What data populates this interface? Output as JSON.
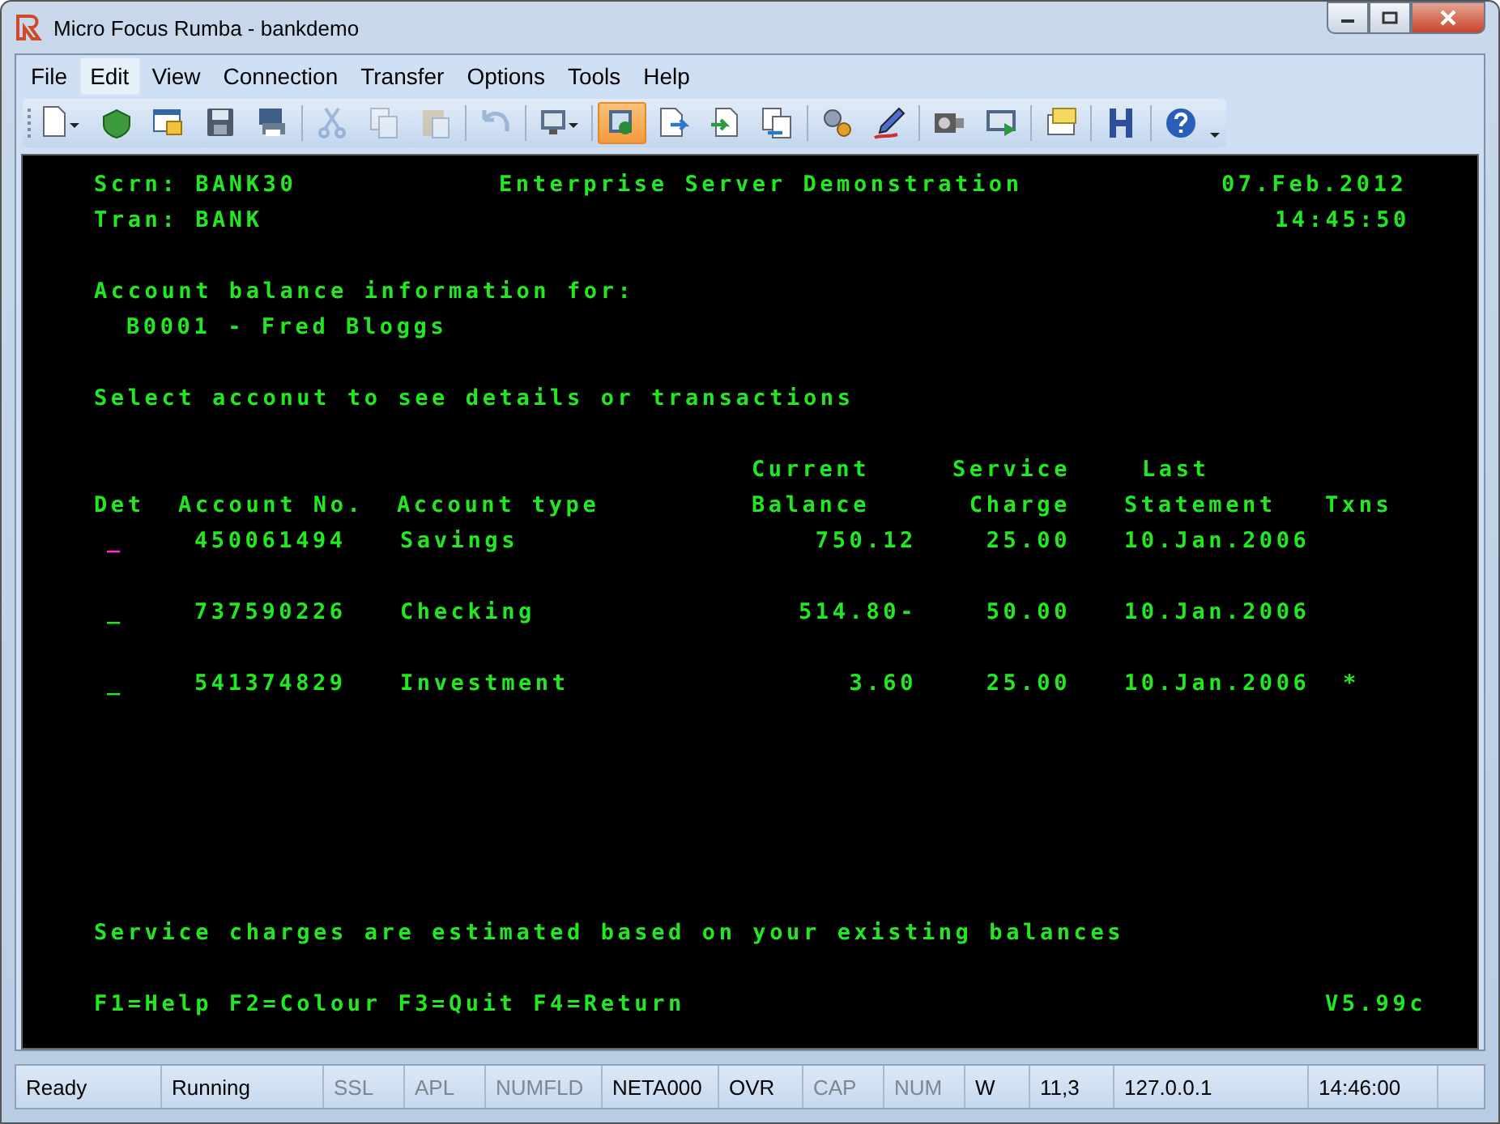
{
  "window": {
    "title": "Micro Focus Rumba - bankdemo"
  },
  "menu": [
    {
      "label": "File",
      "selected": false
    },
    {
      "label": "Edit",
      "selected": true
    },
    {
      "label": "View",
      "selected": false
    },
    {
      "label": "Connection",
      "selected": false
    },
    {
      "label": "Transfer",
      "selected": false
    },
    {
      "label": "Options",
      "selected": false
    },
    {
      "label": "Tools",
      "selected": false
    },
    {
      "label": "Help",
      "selected": false
    }
  ],
  "toolbar": [
    {
      "disabled": false,
      "pressed": false
    },
    {
      "disabled": false,
      "pressed": false
    },
    {
      "disabled": false,
      "pressed": false
    },
    {
      "disabled": false,
      "pressed": false
    },
    {
      "disabled": false,
      "pressed": false
    },
    {
      "disabled": true,
      "pressed": false
    },
    {
      "disabled": true,
      "pressed": false
    },
    {
      "disabled": true,
      "pressed": false
    },
    {
      "disabled": true,
      "pressed": false
    },
    {
      "disabled": false,
      "pressed": false
    },
    {
      "disabled": false,
      "pressed": true
    },
    {
      "disabled": false,
      "pressed": false
    },
    {
      "disabled": false,
      "pressed": false
    },
    {
      "disabled": false,
      "pressed": false
    },
    {
      "disabled": false,
      "pressed": false
    },
    {
      "disabled": false,
      "pressed": false
    },
    {
      "disabled": false,
      "pressed": false
    },
    {
      "disabled": false,
      "pressed": false
    },
    {
      "disabled": false,
      "pressed": false
    },
    {
      "disabled": false,
      "pressed": false
    },
    {
      "disabled": false,
      "pressed": false
    }
  ],
  "terminal": {
    "screen": "Scrn: BANK30",
    "heading": "Enterprise Server Demonstration",
    "date": "07.Feb.2012",
    "tran": "Tran: BANK",
    "time": "14:45:50",
    "info_label": "Account balance information for:",
    "customer": "B0001 - Fred Bloggs",
    "instruction": "Select acconut to see details or transactions",
    "columns": [
      [
        "",
        "Det"
      ],
      [
        "",
        "Account No."
      ],
      [
        "",
        "Account type"
      ],
      [
        "Current",
        "Balance"
      ],
      [
        "Service",
        "Charge"
      ],
      [
        "Last",
        "Statement"
      ],
      [
        "",
        "Txns"
      ]
    ],
    "rows": [
      {
        "det": "_",
        "cursor": true,
        "account": "450061494",
        "type": "Savings",
        "balance": "750.12",
        "charge": "25.00",
        "statement": "10.Jan.2006"
      },
      {
        "det": "_",
        "cursor": false,
        "account": "737590226",
        "type": "Checking",
        "balance": "514.80-",
        "charge": "50.00",
        "statement": "10.Jan.2006"
      },
      {
        "det": "_",
        "cursor": false,
        "account": "541374829",
        "type": "Investment",
        "balance": "3.60",
        "charge": "25.00",
        "statement": "10.Jan.2006",
        "txns": "*"
      }
    ],
    "note": "Service charges are estimated based on your existing balances",
    "keys": "F1=Help F2=Colour F3=Quit F4=Return",
    "version": "V5.99c"
  },
  "status_bar": [
    {
      "text": "Ready",
      "disabled": false
    },
    {
      "text": "Running",
      "disabled": false
    },
    {
      "text": "SSL",
      "disabled": true
    },
    {
      "text": "APL",
      "disabled": true
    },
    {
      "text": "NUMFLD",
      "disabled": true
    },
    {
      "text": "NETA000",
      "disabled": false
    },
    {
      "text": "OVR",
      "disabled": false
    },
    {
      "text": "CAP",
      "disabled": true
    },
    {
      "text": "NUM",
      "disabled": true
    },
    {
      "text": "W",
      "disabled": false
    },
    {
      "text": "11,3",
      "disabled": false
    },
    {
      "text": "127.0.0.1",
      "disabled": false
    },
    {
      "text": "14:46:00",
      "disabled": false
    }
  ]
}
